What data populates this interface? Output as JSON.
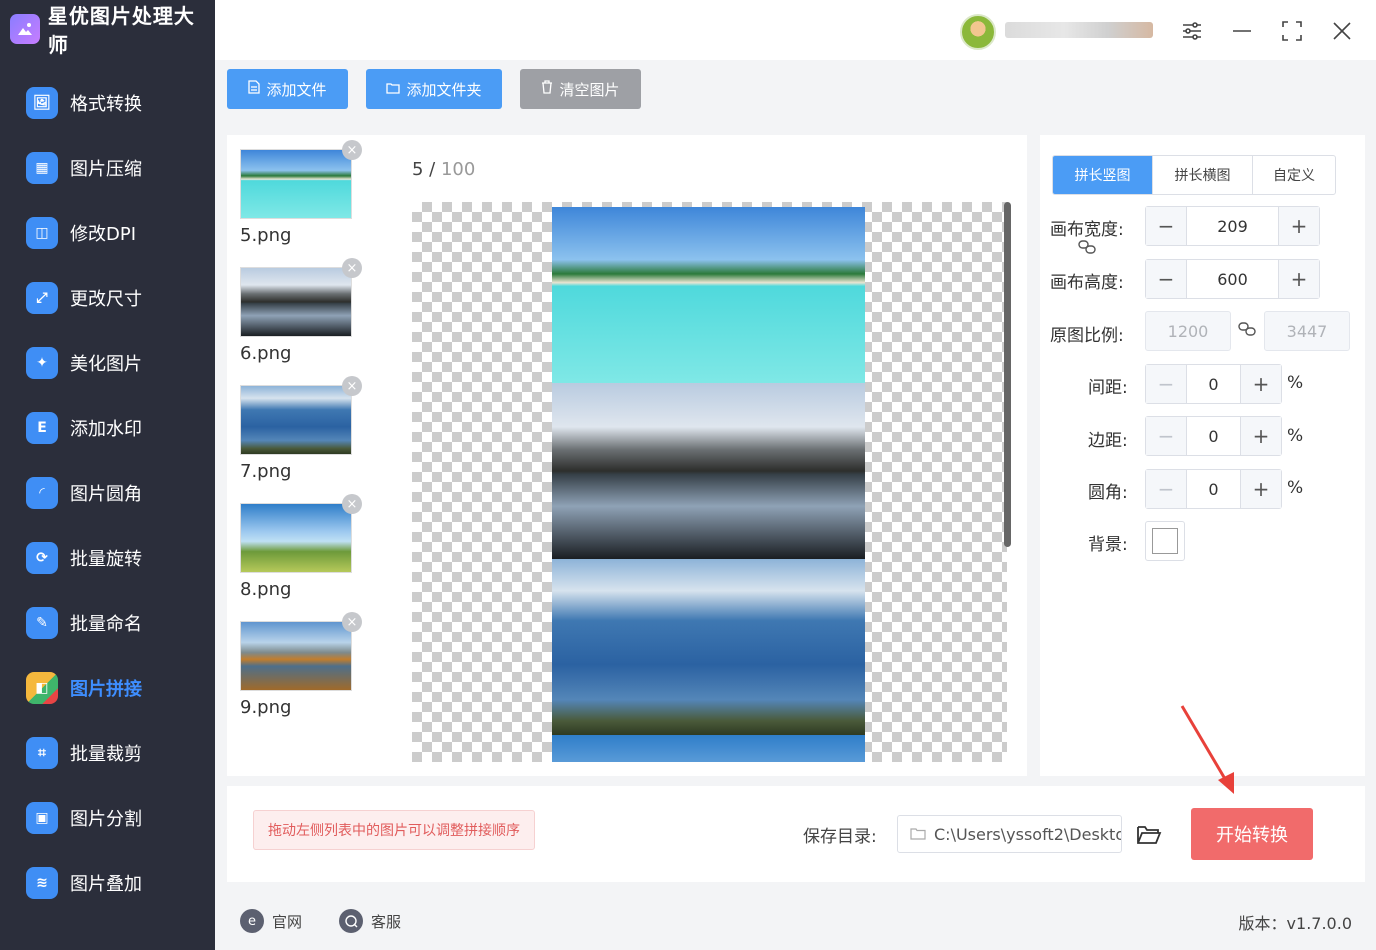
{
  "app": {
    "title": "星优图片处理大师"
  },
  "sidebar": {
    "items": [
      {
        "label": "格式转换",
        "icon": "image-convert-icon",
        "color": "#3f8ef5"
      },
      {
        "label": "图片压缩",
        "icon": "compress-icon",
        "color": "#3f8ef5"
      },
      {
        "label": "修改DPI",
        "icon": "dpi-icon",
        "color": "#3f8ef5"
      },
      {
        "label": "更改尺寸",
        "icon": "resize-icon",
        "color": "#3f8ef5"
      },
      {
        "label": "美化图片",
        "icon": "beautify-icon",
        "color": "#3f8ef5"
      },
      {
        "label": "添加水印",
        "icon": "watermark-icon",
        "color": "#3f8ef5"
      },
      {
        "label": "图片圆角",
        "icon": "round-corner-icon",
        "color": "#3f8ef5"
      },
      {
        "label": "批量旋转",
        "icon": "rotate-icon",
        "color": "#3f8ef5"
      },
      {
        "label": "批量命名",
        "icon": "rename-icon",
        "color": "#3f8ef5"
      },
      {
        "label": "图片拼接",
        "icon": "puzzle-icon",
        "color": "#3f8ef5",
        "active": true
      },
      {
        "label": "批量裁剪",
        "icon": "crop-icon",
        "color": "#3f8ef5"
      },
      {
        "label": "图片分割",
        "icon": "split-icon",
        "color": "#3f8ef5"
      },
      {
        "label": "图片叠加",
        "icon": "layers-icon",
        "color": "#3f8ef5"
      }
    ]
  },
  "toolbar": {
    "add_file": "添加文件",
    "add_folder": "添加文件夹",
    "clear": "清空图片"
  },
  "file_list": [
    {
      "name": "5.png",
      "scene": "beach"
    },
    {
      "name": "6.png",
      "scene": "lake-mountain"
    },
    {
      "name": "7.png",
      "scene": "blue-mountains"
    },
    {
      "name": "8.png",
      "scene": "tree-field"
    },
    {
      "name": "9.png",
      "scene": "autumn-lake"
    }
  ],
  "preview": {
    "current": "5",
    "total": "100"
  },
  "settings": {
    "tabs": [
      "拼长竖图",
      "拼长横图",
      "自定义"
    ],
    "active_tab": 0,
    "canvas_width_label": "画布宽度:",
    "canvas_width": "209",
    "canvas_height_label": "画布高度:",
    "canvas_height": "600",
    "ratio_label": "原图比例:",
    "ratio_w": "1200",
    "ratio_h": "3447",
    "spacing_label": "间距:",
    "spacing": "0",
    "margin_label": "边距:",
    "margin": "0",
    "radius_label": "圆角:",
    "radius": "0",
    "percent": "%",
    "bg_label": "背景:"
  },
  "bottom": {
    "hint": "拖动左侧列表中的图片可以调整拼接顺序",
    "save_label": "保存目录:",
    "save_path": "C:\\Users\\yssoft2\\Deskto",
    "start": "开始转换"
  },
  "footer": {
    "website": "官网",
    "support": "客服",
    "version": "版本：v1.7.0.0"
  },
  "colors": {
    "accent": "#4b9cf5",
    "danger": "#f16b6b",
    "sidebar": "#2b2e3b"
  }
}
